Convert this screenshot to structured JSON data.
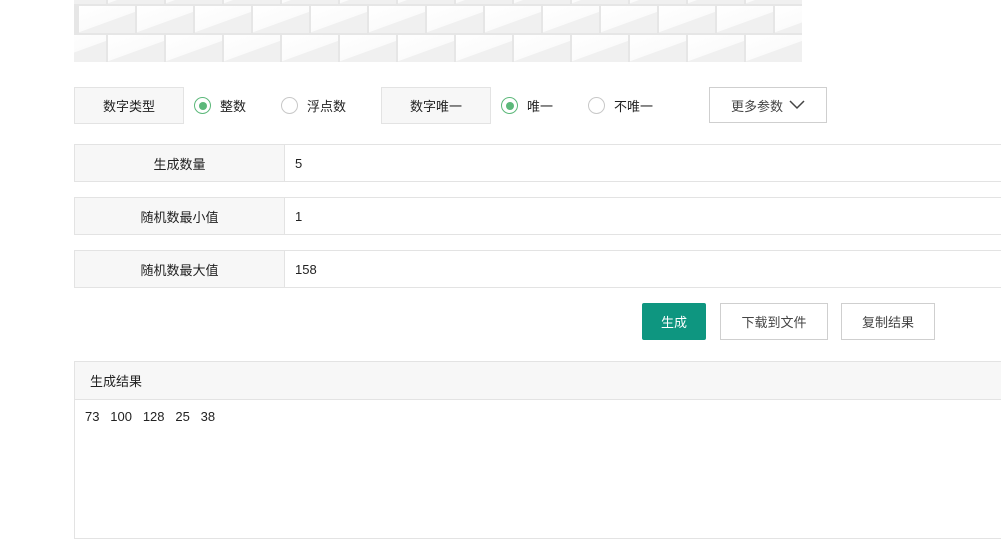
{
  "options": {
    "number_type_label": "数字类型",
    "integer_label": "整数",
    "float_label": "浮点数",
    "integer_selected": true,
    "unique_label": "数字唯一",
    "unique_option": "唯一",
    "not_unique_option": "不唯一",
    "unique_selected": true,
    "more_params": "更多参数"
  },
  "fields": [
    {
      "label": "生成数量",
      "value": "5"
    },
    {
      "label": "随机数最小值",
      "value": "1"
    },
    {
      "label": "随机数最大值",
      "value": "158"
    }
  ],
  "buttons": {
    "generate": "生成",
    "download": "下载到文件",
    "copy": "复制结果"
  },
  "result": {
    "title": "生成结果",
    "values": "73   100   128   25   38"
  },
  "colors": {
    "primary": "#0e9680",
    "radio": "#5cb87a"
  }
}
